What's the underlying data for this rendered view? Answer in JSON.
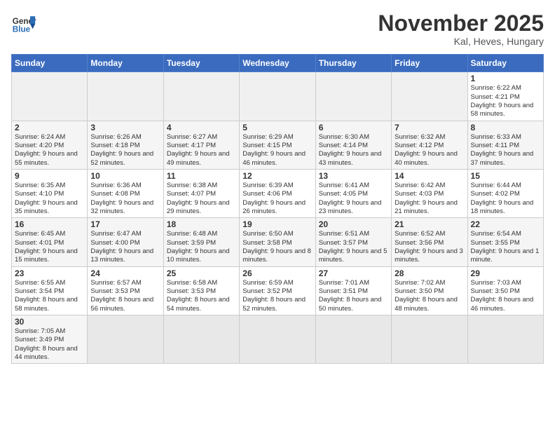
{
  "logo": {
    "text_general": "General",
    "text_blue": "Blue"
  },
  "header": {
    "month": "November 2025",
    "location": "Kal, Heves, Hungary"
  },
  "weekdays": [
    "Sunday",
    "Monday",
    "Tuesday",
    "Wednesday",
    "Thursday",
    "Friday",
    "Saturday"
  ],
  "weeks": [
    [
      {
        "day": "",
        "empty": true
      },
      {
        "day": "",
        "empty": true
      },
      {
        "day": "",
        "empty": true
      },
      {
        "day": "",
        "empty": true
      },
      {
        "day": "",
        "empty": true
      },
      {
        "day": "",
        "empty": true
      },
      {
        "day": "1",
        "sunrise": "6:22 AM",
        "sunset": "4:21 PM",
        "daylight": "9 hours and 58 minutes."
      }
    ],
    [
      {
        "day": "2",
        "sunrise": "6:24 AM",
        "sunset": "4:20 PM",
        "daylight": "9 hours and 55 minutes."
      },
      {
        "day": "3",
        "sunrise": "6:26 AM",
        "sunset": "4:18 PM",
        "daylight": "9 hours and 52 minutes."
      },
      {
        "day": "4",
        "sunrise": "6:27 AM",
        "sunset": "4:17 PM",
        "daylight": "9 hours and 49 minutes."
      },
      {
        "day": "5",
        "sunrise": "6:29 AM",
        "sunset": "4:15 PM",
        "daylight": "9 hours and 46 minutes."
      },
      {
        "day": "6",
        "sunrise": "6:30 AM",
        "sunset": "4:14 PM",
        "daylight": "9 hours and 43 minutes."
      },
      {
        "day": "7",
        "sunrise": "6:32 AM",
        "sunset": "4:12 PM",
        "daylight": "9 hours and 40 minutes."
      },
      {
        "day": "8",
        "sunrise": "6:33 AM",
        "sunset": "4:11 PM",
        "daylight": "9 hours and 37 minutes."
      }
    ],
    [
      {
        "day": "9",
        "sunrise": "6:35 AM",
        "sunset": "4:10 PM",
        "daylight": "9 hours and 35 minutes."
      },
      {
        "day": "10",
        "sunrise": "6:36 AM",
        "sunset": "4:08 PM",
        "daylight": "9 hours and 32 minutes."
      },
      {
        "day": "11",
        "sunrise": "6:38 AM",
        "sunset": "4:07 PM",
        "daylight": "9 hours and 29 minutes."
      },
      {
        "day": "12",
        "sunrise": "6:39 AM",
        "sunset": "4:06 PM",
        "daylight": "9 hours and 26 minutes."
      },
      {
        "day": "13",
        "sunrise": "6:41 AM",
        "sunset": "4:05 PM",
        "daylight": "9 hours and 23 minutes."
      },
      {
        "day": "14",
        "sunrise": "6:42 AM",
        "sunset": "4:03 PM",
        "daylight": "9 hours and 21 minutes."
      },
      {
        "day": "15",
        "sunrise": "6:44 AM",
        "sunset": "4:02 PM",
        "daylight": "9 hours and 18 minutes."
      }
    ],
    [
      {
        "day": "16",
        "sunrise": "6:45 AM",
        "sunset": "4:01 PM",
        "daylight": "9 hours and 15 minutes."
      },
      {
        "day": "17",
        "sunrise": "6:47 AM",
        "sunset": "4:00 PM",
        "daylight": "9 hours and 13 minutes."
      },
      {
        "day": "18",
        "sunrise": "6:48 AM",
        "sunset": "3:59 PM",
        "daylight": "9 hours and 10 minutes."
      },
      {
        "day": "19",
        "sunrise": "6:50 AM",
        "sunset": "3:58 PM",
        "daylight": "9 hours and 8 minutes."
      },
      {
        "day": "20",
        "sunrise": "6:51 AM",
        "sunset": "3:57 PM",
        "daylight": "9 hours and 5 minutes."
      },
      {
        "day": "21",
        "sunrise": "6:52 AM",
        "sunset": "3:56 PM",
        "daylight": "9 hours and 3 minutes."
      },
      {
        "day": "22",
        "sunrise": "6:54 AM",
        "sunset": "3:55 PM",
        "daylight": "9 hours and 1 minute."
      }
    ],
    [
      {
        "day": "23",
        "sunrise": "6:55 AM",
        "sunset": "3:54 PM",
        "daylight": "8 hours and 58 minutes."
      },
      {
        "day": "24",
        "sunrise": "6:57 AM",
        "sunset": "3:53 PM",
        "daylight": "8 hours and 56 minutes."
      },
      {
        "day": "25",
        "sunrise": "6:58 AM",
        "sunset": "3:53 PM",
        "daylight": "8 hours and 54 minutes."
      },
      {
        "day": "26",
        "sunrise": "6:59 AM",
        "sunset": "3:52 PM",
        "daylight": "8 hours and 52 minutes."
      },
      {
        "day": "27",
        "sunrise": "7:01 AM",
        "sunset": "3:51 PM",
        "daylight": "8 hours and 50 minutes."
      },
      {
        "day": "28",
        "sunrise": "7:02 AM",
        "sunset": "3:50 PM",
        "daylight": "8 hours and 48 minutes."
      },
      {
        "day": "29",
        "sunrise": "7:03 AM",
        "sunset": "3:50 PM",
        "daylight": "8 hours and 46 minutes."
      }
    ],
    [
      {
        "day": "30",
        "sunrise": "7:05 AM",
        "sunset": "3:49 PM",
        "daylight": "8 hours and 44 minutes."
      },
      {
        "day": "",
        "empty": true
      },
      {
        "day": "",
        "empty": true
      },
      {
        "day": "",
        "empty": true
      },
      {
        "day": "",
        "empty": true
      },
      {
        "day": "",
        "empty": true
      },
      {
        "day": "",
        "empty": true
      }
    ]
  ]
}
